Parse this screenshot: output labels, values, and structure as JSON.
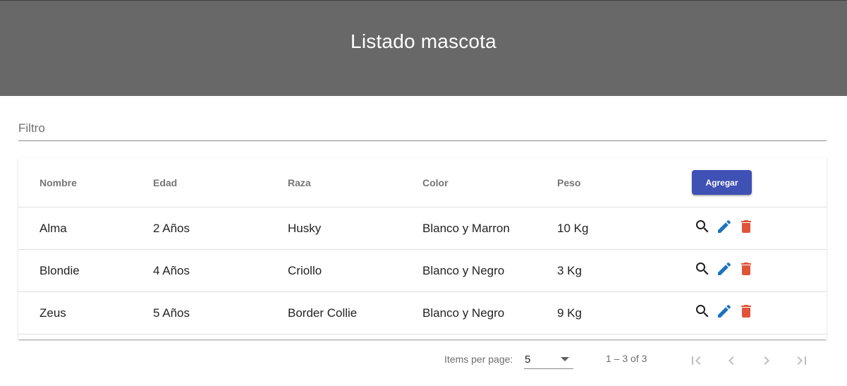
{
  "header": {
    "title": "Listado mascota"
  },
  "filter": {
    "placeholder": "Filtro"
  },
  "table": {
    "columns": [
      "Nombre",
      "Edad",
      "Raza",
      "Color",
      "Peso"
    ],
    "add_label": "Agregar",
    "rows": [
      {
        "nombre": "Alma",
        "edad": "2 Años",
        "raza": "Husky",
        "color": "Blanco y Marron",
        "peso": "10 Kg"
      },
      {
        "nombre": "Blondie",
        "edad": "4 Años",
        "raza": "Criollo",
        "color": "Blanco y Negro",
        "peso": "3 Kg"
      },
      {
        "nombre": "Zeus",
        "edad": "5 Años",
        "raza": "Border Collie",
        "color": "Blanco y Negro",
        "peso": "9 Kg"
      }
    ],
    "action_icons": [
      "search-icon",
      "edit-icon",
      "delete-icon"
    ]
  },
  "paginator": {
    "items_per_page_label": "Items per page:",
    "page_size": "5",
    "range_label": "1 – 3 of 3"
  },
  "colors": {
    "header_bg": "#686868",
    "primary": "#3f51b5",
    "edit": "#1e73be",
    "delete": "#e0543a"
  }
}
